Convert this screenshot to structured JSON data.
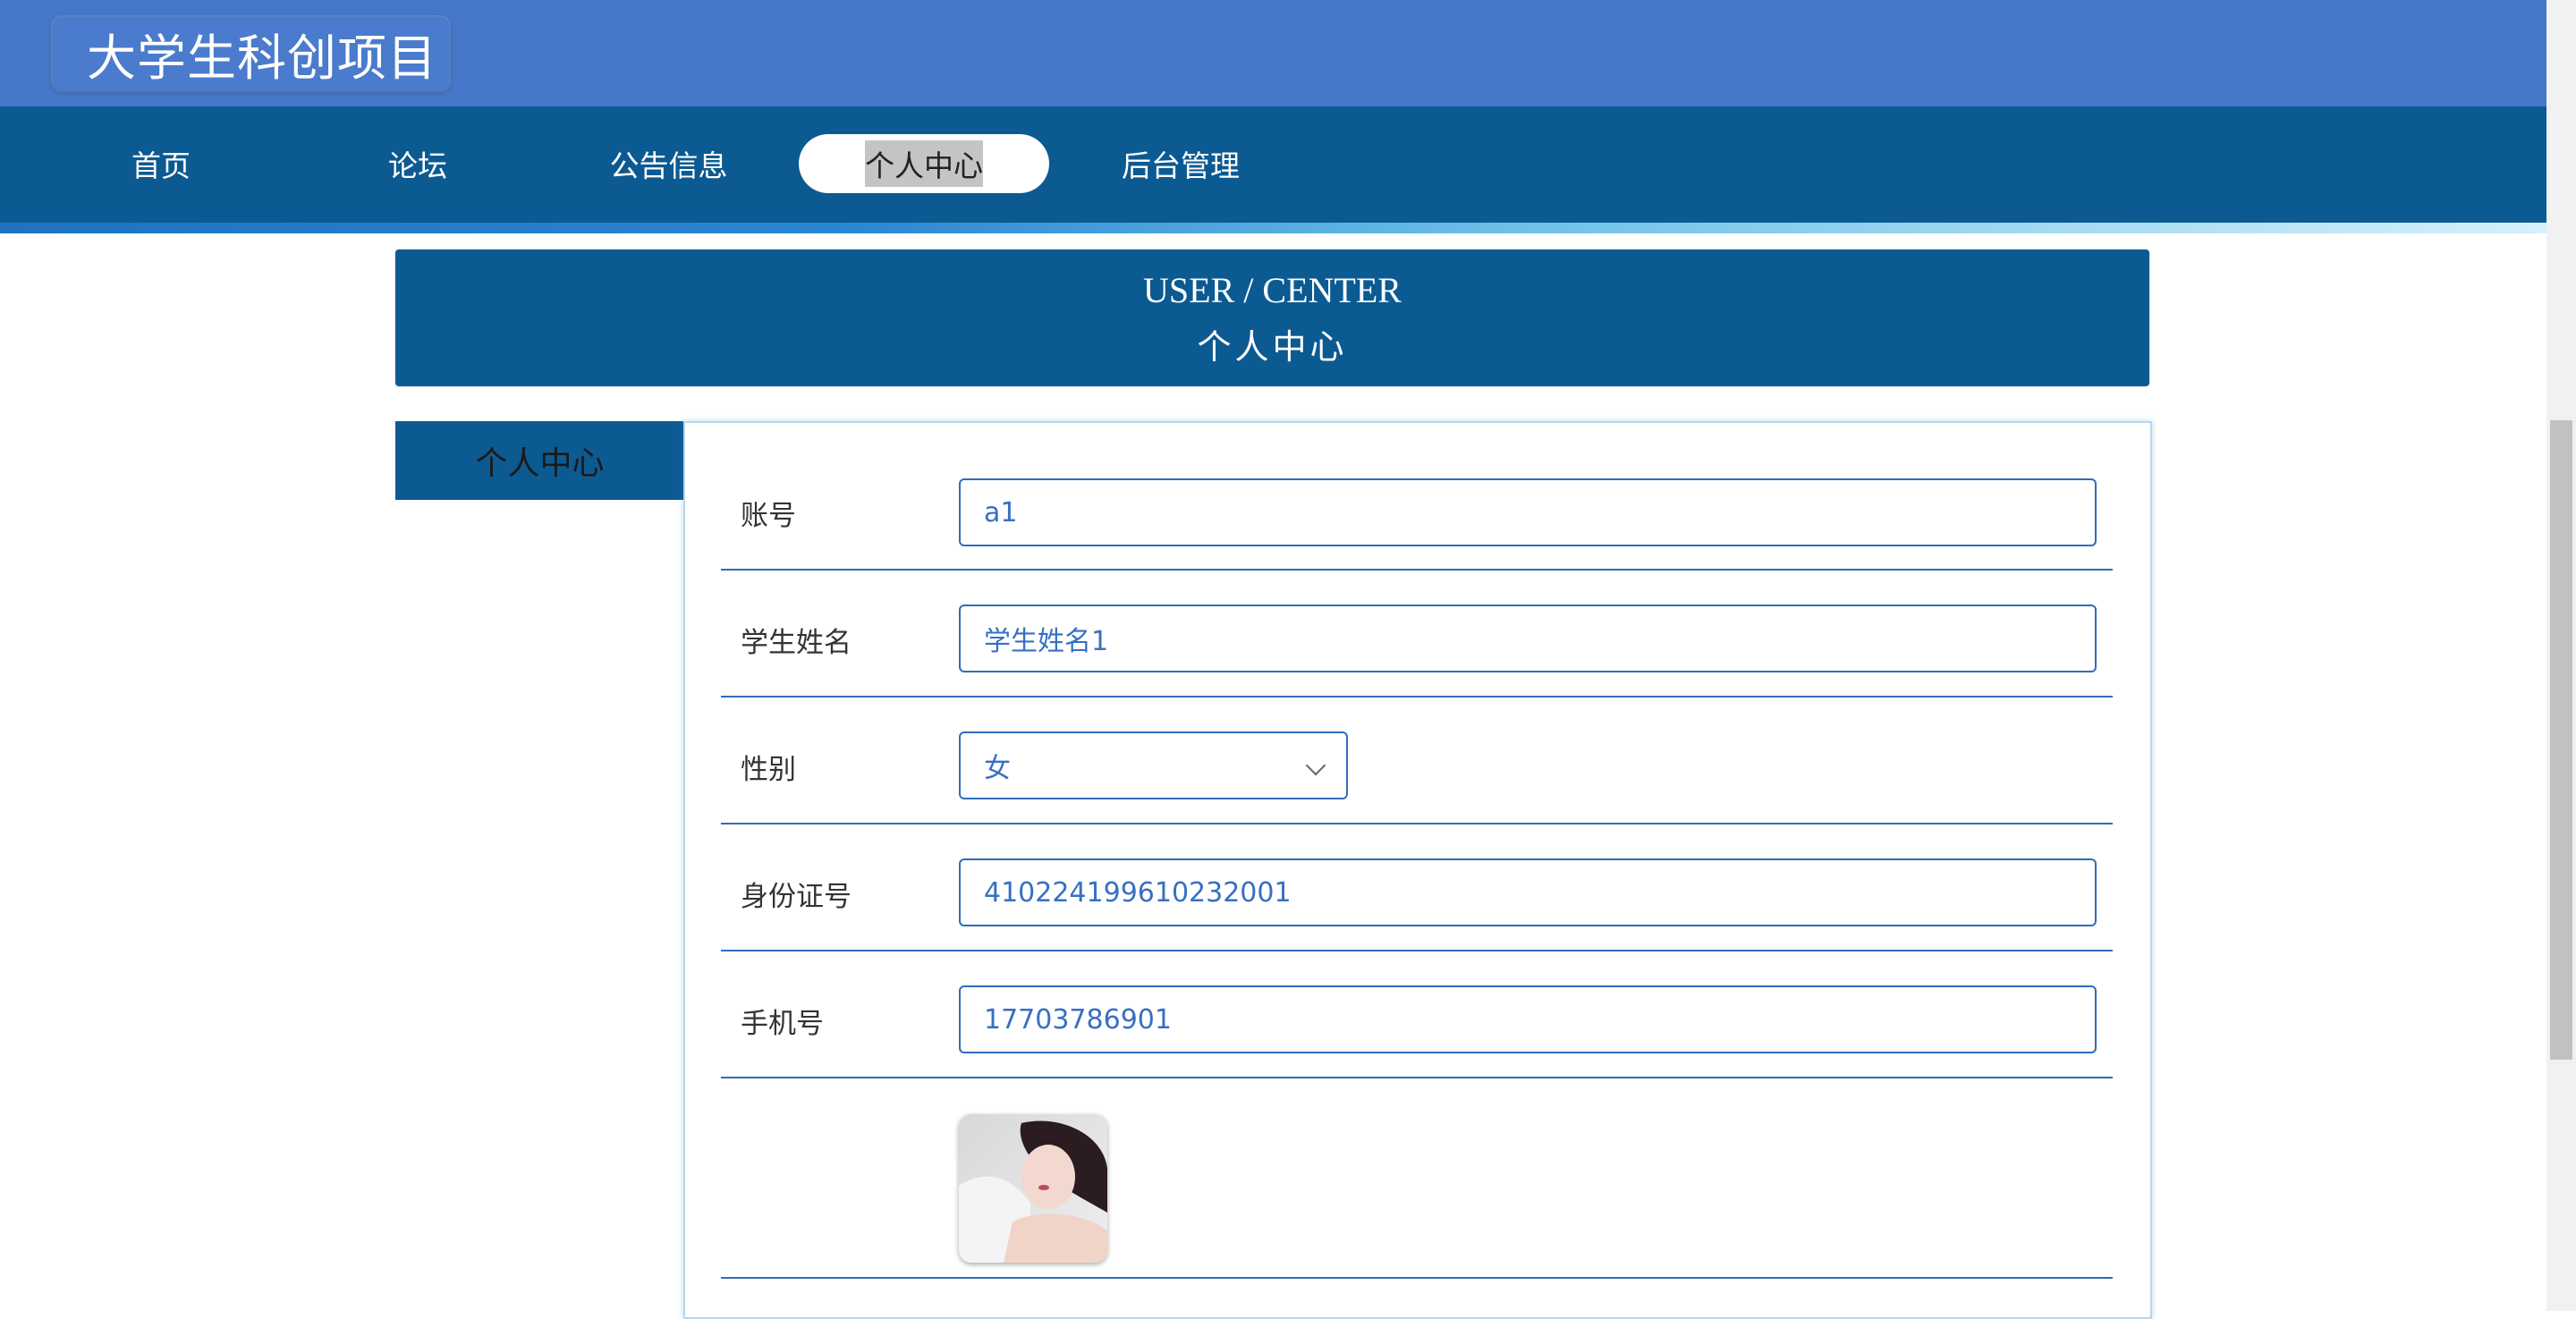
{
  "app": {
    "title": "大学生科创项目"
  },
  "nav": {
    "items": [
      {
        "label": "首页"
      },
      {
        "label": "论坛"
      },
      {
        "label": "公告信息"
      },
      {
        "label": "个人中心",
        "active": true
      },
      {
        "label": "后台管理"
      }
    ]
  },
  "user_center": {
    "title_en": "USER / CENTER",
    "title_cn": "个人中心",
    "side_tab": "个人中心"
  },
  "form": {
    "account": {
      "label": "账号",
      "value": "a1"
    },
    "name": {
      "label": "学生姓名",
      "value": "学生姓名1"
    },
    "gender": {
      "label": "性别",
      "value": "女"
    },
    "id_card": {
      "label": "身份证号",
      "value": "410224199610232001"
    },
    "phone": {
      "label": "手机号",
      "value": "17703786901"
    }
  },
  "colors": {
    "topbar": "#4677c8",
    "navbar": "#0c5a92",
    "accent": "#2f6db8",
    "input_text": "#3770c2"
  }
}
